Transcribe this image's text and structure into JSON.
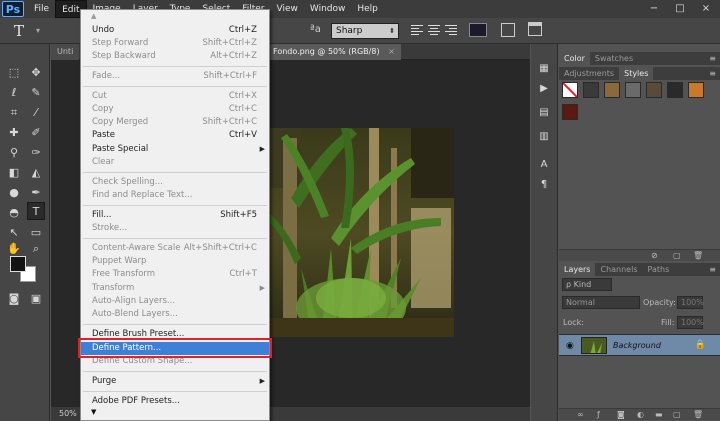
{
  "app_logo": "Ps",
  "menubar": {
    "items": [
      "File",
      "Edit",
      "Image",
      "Layer",
      "Type",
      "Select",
      "Filter",
      "View",
      "Window",
      "Help"
    ],
    "window_controls": [
      "−",
      "□",
      "×"
    ]
  },
  "optionsbar": {
    "tool_preset": "T",
    "aa_label": "ªa",
    "aa_value": "Sharp"
  },
  "document": {
    "tabs": [
      {
        "label": "Unti",
        "close": "×"
      },
      {
        "label": "Fondo.png @ 50% (RGB/8)",
        "close": "×"
      }
    ],
    "zoom": "50%"
  },
  "edit_menu": {
    "items": [
      {
        "label": "Undo",
        "shortcut": "Ctrl+Z",
        "disabled": false
      },
      {
        "label": "Step Forward",
        "shortcut": "Shift+Ctrl+Z",
        "disabled": true
      },
      {
        "label": "Step Backward",
        "shortcut": "Alt+Ctrl+Z",
        "disabled": true
      },
      {
        "label": "Fade...",
        "shortcut": "Shift+Ctrl+F",
        "disabled": true
      },
      {
        "label": "Cut",
        "shortcut": "Ctrl+X",
        "disabled": true
      },
      {
        "label": "Copy",
        "shortcut": "Ctrl+C",
        "disabled": true
      },
      {
        "label": "Copy Merged",
        "shortcut": "Shift+Ctrl+C",
        "disabled": true
      },
      {
        "label": "Paste",
        "shortcut": "Ctrl+V",
        "disabled": false
      },
      {
        "label": "Paste Special",
        "shortcut": "",
        "disabled": false
      },
      {
        "label": "Clear",
        "shortcut": "",
        "disabled": true
      },
      {
        "label": "Check Spelling...",
        "shortcut": "",
        "disabled": true
      },
      {
        "label": "Find and Replace Text...",
        "shortcut": "",
        "disabled": true
      },
      {
        "label": "Fill...",
        "shortcut": "Shift+F5",
        "disabled": false
      },
      {
        "label": "Stroke...",
        "shortcut": "",
        "disabled": true
      },
      {
        "label": "Content-Aware Scale",
        "shortcut": "Alt+Shift+Ctrl+C",
        "disabled": true
      },
      {
        "label": "Puppet Warp",
        "shortcut": "",
        "disabled": true
      },
      {
        "label": "Free Transform",
        "shortcut": "Ctrl+T",
        "disabled": true
      },
      {
        "label": "Transform",
        "shortcut": "",
        "disabled": true
      },
      {
        "label": "Auto-Align Layers...",
        "shortcut": "",
        "disabled": true
      },
      {
        "label": "Auto-Blend Layers...",
        "shortcut": "",
        "disabled": true
      },
      {
        "label": "Define Brush Preset...",
        "shortcut": "",
        "disabled": false
      },
      {
        "label": "Define Pattern...",
        "shortcut": "",
        "disabled": false,
        "highlighted": true
      },
      {
        "label": "Define Custom Shape...",
        "shortcut": "",
        "disabled": true
      },
      {
        "label": "Purge",
        "shortcut": "",
        "disabled": false
      },
      {
        "label": "Adobe PDF Presets...",
        "shortcut": "",
        "disabled": false
      }
    ]
  },
  "panels": {
    "color_tabs": [
      "Color",
      "Swatches"
    ],
    "style_tabs": [
      "Adjustments",
      "Styles"
    ],
    "layers_tabs": [
      "Layers",
      "Channels",
      "Paths"
    ],
    "kind_select": "ρ Kind",
    "blend_mode": "Normal",
    "opacity_label": "Opacity:",
    "opacity_value": "100%",
    "lock_label": "Lock:",
    "fill_label": "Fill:",
    "fill_value": "100%",
    "layer_name": "Background"
  },
  "colors": {
    "highlight": "#3e7fd8",
    "callout": "#e0202a",
    "layer_selected": "#6f8aa8"
  }
}
